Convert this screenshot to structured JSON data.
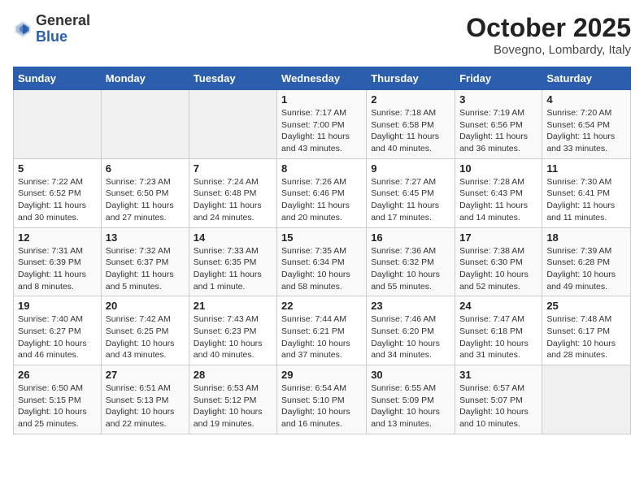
{
  "header": {
    "logo_general": "General",
    "logo_blue": "Blue",
    "month": "October 2025",
    "location": "Bovegno, Lombardy, Italy"
  },
  "days_of_week": [
    "Sunday",
    "Monday",
    "Tuesday",
    "Wednesday",
    "Thursday",
    "Friday",
    "Saturday"
  ],
  "weeks": [
    [
      {
        "day": "",
        "info": ""
      },
      {
        "day": "",
        "info": ""
      },
      {
        "day": "",
        "info": ""
      },
      {
        "day": "1",
        "info": "Sunrise: 7:17 AM\nSunset: 7:00 PM\nDaylight: 11 hours\nand 43 minutes."
      },
      {
        "day": "2",
        "info": "Sunrise: 7:18 AM\nSunset: 6:58 PM\nDaylight: 11 hours\nand 40 minutes."
      },
      {
        "day": "3",
        "info": "Sunrise: 7:19 AM\nSunset: 6:56 PM\nDaylight: 11 hours\nand 36 minutes."
      },
      {
        "day": "4",
        "info": "Sunrise: 7:20 AM\nSunset: 6:54 PM\nDaylight: 11 hours\nand 33 minutes."
      }
    ],
    [
      {
        "day": "5",
        "info": "Sunrise: 7:22 AM\nSunset: 6:52 PM\nDaylight: 11 hours\nand 30 minutes."
      },
      {
        "day": "6",
        "info": "Sunrise: 7:23 AM\nSunset: 6:50 PM\nDaylight: 11 hours\nand 27 minutes."
      },
      {
        "day": "7",
        "info": "Sunrise: 7:24 AM\nSunset: 6:48 PM\nDaylight: 11 hours\nand 24 minutes."
      },
      {
        "day": "8",
        "info": "Sunrise: 7:26 AM\nSunset: 6:46 PM\nDaylight: 11 hours\nand 20 minutes."
      },
      {
        "day": "9",
        "info": "Sunrise: 7:27 AM\nSunset: 6:45 PM\nDaylight: 11 hours\nand 17 minutes."
      },
      {
        "day": "10",
        "info": "Sunrise: 7:28 AM\nSunset: 6:43 PM\nDaylight: 11 hours\nand 14 minutes."
      },
      {
        "day": "11",
        "info": "Sunrise: 7:30 AM\nSunset: 6:41 PM\nDaylight: 11 hours\nand 11 minutes."
      }
    ],
    [
      {
        "day": "12",
        "info": "Sunrise: 7:31 AM\nSunset: 6:39 PM\nDaylight: 11 hours\nand 8 minutes."
      },
      {
        "day": "13",
        "info": "Sunrise: 7:32 AM\nSunset: 6:37 PM\nDaylight: 11 hours\nand 5 minutes."
      },
      {
        "day": "14",
        "info": "Sunrise: 7:33 AM\nSunset: 6:35 PM\nDaylight: 11 hours\nand 1 minute."
      },
      {
        "day": "15",
        "info": "Sunrise: 7:35 AM\nSunset: 6:34 PM\nDaylight: 10 hours\nand 58 minutes."
      },
      {
        "day": "16",
        "info": "Sunrise: 7:36 AM\nSunset: 6:32 PM\nDaylight: 10 hours\nand 55 minutes."
      },
      {
        "day": "17",
        "info": "Sunrise: 7:38 AM\nSunset: 6:30 PM\nDaylight: 10 hours\nand 52 minutes."
      },
      {
        "day": "18",
        "info": "Sunrise: 7:39 AM\nSunset: 6:28 PM\nDaylight: 10 hours\nand 49 minutes."
      }
    ],
    [
      {
        "day": "19",
        "info": "Sunrise: 7:40 AM\nSunset: 6:27 PM\nDaylight: 10 hours\nand 46 minutes."
      },
      {
        "day": "20",
        "info": "Sunrise: 7:42 AM\nSunset: 6:25 PM\nDaylight: 10 hours\nand 43 minutes."
      },
      {
        "day": "21",
        "info": "Sunrise: 7:43 AM\nSunset: 6:23 PM\nDaylight: 10 hours\nand 40 minutes."
      },
      {
        "day": "22",
        "info": "Sunrise: 7:44 AM\nSunset: 6:21 PM\nDaylight: 10 hours\nand 37 minutes."
      },
      {
        "day": "23",
        "info": "Sunrise: 7:46 AM\nSunset: 6:20 PM\nDaylight: 10 hours\nand 34 minutes."
      },
      {
        "day": "24",
        "info": "Sunrise: 7:47 AM\nSunset: 6:18 PM\nDaylight: 10 hours\nand 31 minutes."
      },
      {
        "day": "25",
        "info": "Sunrise: 7:48 AM\nSunset: 6:17 PM\nDaylight: 10 hours\nand 28 minutes."
      }
    ],
    [
      {
        "day": "26",
        "info": "Sunrise: 6:50 AM\nSunset: 5:15 PM\nDaylight: 10 hours\nand 25 minutes."
      },
      {
        "day": "27",
        "info": "Sunrise: 6:51 AM\nSunset: 5:13 PM\nDaylight: 10 hours\nand 22 minutes."
      },
      {
        "day": "28",
        "info": "Sunrise: 6:53 AM\nSunset: 5:12 PM\nDaylight: 10 hours\nand 19 minutes."
      },
      {
        "day": "29",
        "info": "Sunrise: 6:54 AM\nSunset: 5:10 PM\nDaylight: 10 hours\nand 16 minutes."
      },
      {
        "day": "30",
        "info": "Sunrise: 6:55 AM\nSunset: 5:09 PM\nDaylight: 10 hours\nand 13 minutes."
      },
      {
        "day": "31",
        "info": "Sunrise: 6:57 AM\nSunset: 5:07 PM\nDaylight: 10 hours\nand 10 minutes."
      },
      {
        "day": "",
        "info": ""
      }
    ]
  ]
}
